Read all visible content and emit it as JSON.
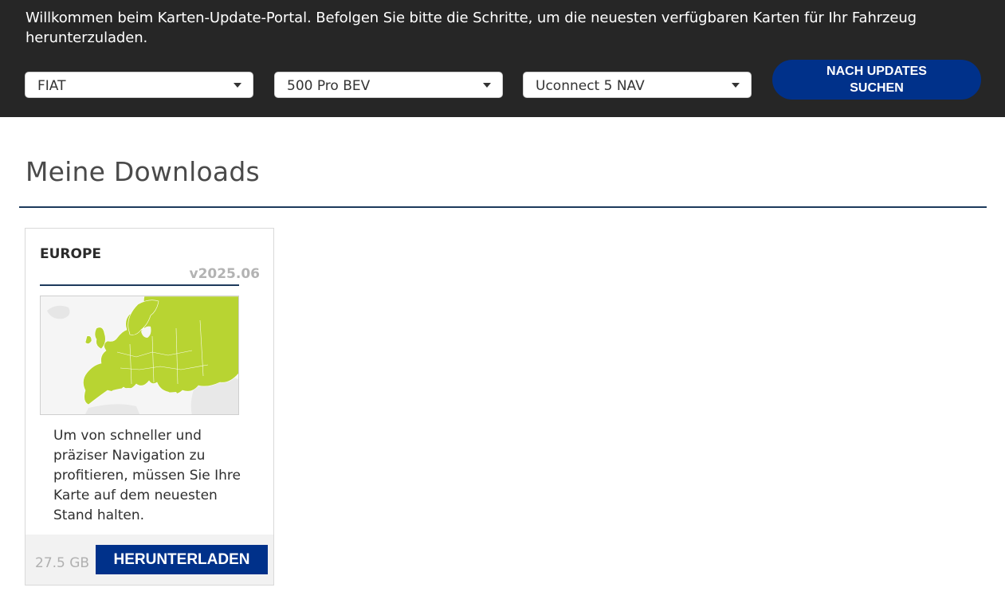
{
  "header": {
    "welcome_text": "Willkommen beim Karten-Update-Portal. Befolgen Sie bitte die Schritte, um die neuesten verfügbaren Karten für Ihr Fahrzeug herunterzuladen.",
    "brand_select": {
      "value": "FIAT"
    },
    "model_select": {
      "value": "500 Pro BEV"
    },
    "system_select": {
      "value": "Uconnect 5 NAV"
    },
    "search_button_line1": "NACH UPDATES",
    "search_button_line2": "SUCHEN"
  },
  "main": {
    "title": "Meine Downloads",
    "downloads": [
      {
        "region": "EUROPE",
        "version": "v2025.06",
        "description": "Um von schneller und präziser Navigation zu profitieren, müssen Sie Ihre Karte auf dem neuesten Stand halten.",
        "size": "27.5 GB",
        "download_label": "HERUNTERLADEN"
      }
    ]
  },
  "colors": {
    "header_bg": "#262626",
    "accent": "#00318a",
    "rule": "#1d3a5c",
    "map_land": "#b8d432"
  },
  "icons": [
    "caret-down-icon",
    "europe-map-image"
  ]
}
